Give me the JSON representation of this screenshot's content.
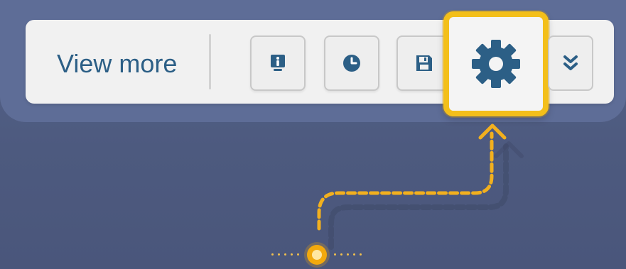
{
  "toolbar": {
    "view_more_label": "View more",
    "buttons": [
      {
        "name": "info",
        "icon": "info-icon"
      },
      {
        "name": "history",
        "icon": "clock-icon"
      },
      {
        "name": "save",
        "icon": "floppy-disk-icon"
      },
      {
        "name": "settings",
        "icon": "gear-icon"
      },
      {
        "name": "more",
        "icon": "double-chevron-down-icon"
      }
    ]
  },
  "colors": {
    "background": "#56648a",
    "toolbar": "#f1f1f1",
    "text": "#2c5f86",
    "icon": "#2c5f86",
    "highlight": "#f3bf1a",
    "path": "#f2b01e"
  }
}
